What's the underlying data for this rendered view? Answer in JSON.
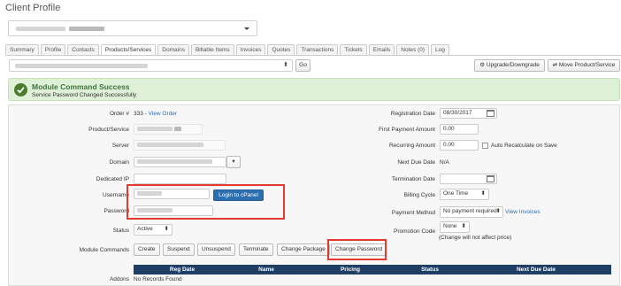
{
  "page": {
    "title": "Client Profile"
  },
  "tabs": [
    "Summary",
    "Profile",
    "Contacts",
    "Products/Services",
    "Domains",
    "Billable Items",
    "Invoices",
    "Quotes",
    "Transactions",
    "Tickets",
    "Emails",
    "Notes (0)",
    "Log"
  ],
  "toolbar": {
    "go_label": "Go",
    "upgrade_label": "Upgrade/Downgrade",
    "move_label": "Move Product/Service"
  },
  "alert": {
    "title": "Module Command Success",
    "message": "Service Password Changed Successfully"
  },
  "form": {
    "order_label": "Order #",
    "order_value": "333 - ",
    "view_order": "View Order",
    "product_label": "Product/Service",
    "server_label": "Server",
    "domain_label": "Domain",
    "dedicated_ip_label": "Dedicated IP",
    "username_label": "Username",
    "password_label": "Password",
    "login_cpanel": "Login to cPanel",
    "status_label": "Status",
    "status_value": "Active",
    "module_commands_label": "Module Commands",
    "commands": [
      "Create",
      "Suspend",
      "Unsuspend",
      "Terminate",
      "Change Package",
      "Change Password"
    ],
    "addons_label": "Addons",
    "registration_date_label": "Registration Date",
    "registration_date": "08/30/2017",
    "first_payment_label": "First Payment Amount",
    "first_payment": "0.00",
    "recurring_label": "Recurring Amount",
    "recurring": "0.00",
    "auto_recalc": "Auto Recalculate on Save",
    "next_due_label": "Next Due Date",
    "next_due": "N/A",
    "termination_label": "Termination Date",
    "billing_cycle_label": "Billing Cycle",
    "billing_cycle": "One Time",
    "payment_method_label": "Payment Method",
    "payment_method": "No payment required",
    "view_invoices": "View Invoices",
    "promo_label": "Promotion Code",
    "promo_value": "None",
    "promo_note": "(Change will not affect price)"
  },
  "addons": {
    "columns": [
      "Reg Date",
      "Name",
      "Pricing",
      "Status",
      "Next Due Date"
    ],
    "empty": "No Records Found"
  },
  "colors": {
    "accent": "#2c6eb0",
    "success_bg": "#dff0d8",
    "success_text": "#3c763d",
    "highlight": "#e23a2e",
    "table_head": "#1f3e64"
  }
}
